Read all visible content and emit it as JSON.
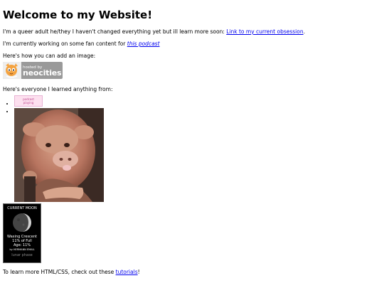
{
  "heading": "Welcome to my Website!",
  "intro": {
    "text": "I'm a queer adult he/they I haven't changed everything yet but ill learn more soon: ",
    "link": "Link to my current obsession",
    "suffix": "."
  },
  "fan": {
    "text": "I'm currently working on some fan content for ",
    "link": "this podcast"
  },
  "image_prompt": "Here's how you can add an image:",
  "badge": {
    "small": "hosted by",
    "big": "neocities"
  },
  "learned_prompt": "Here's everyone I learned anything from:",
  "list_items": [
    {
      "type": "podcast-button",
      "line1": "podcast",
      "line2": "playing"
    },
    {
      "type": "cow-photo"
    }
  ],
  "moon": {
    "title": "CURRENT MOON",
    "phase": "Waxing Crescent",
    "percent": "11% of Full",
    "age": "Age: 11%",
    "source": "by HERMANN EMAIL",
    "footer": "lunar phase"
  },
  "tutorials": {
    "text": "To learn more HTML/CSS, check out these ",
    "link": "tutorials",
    "suffix": "!"
  },
  "colors": {
    "link": "#0000ee",
    "badge": "#9a9a9a",
    "cat": "#f4a340"
  }
}
